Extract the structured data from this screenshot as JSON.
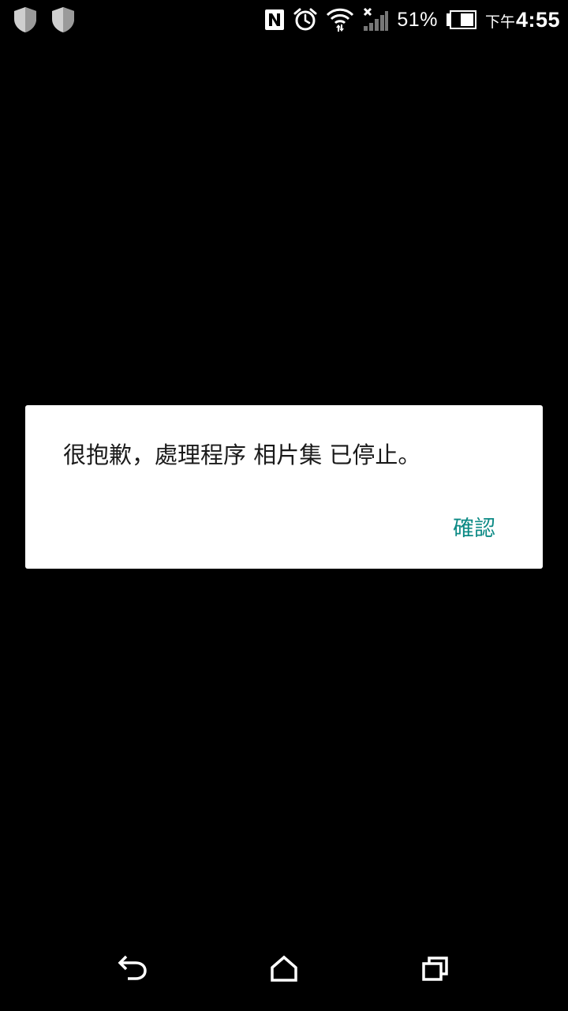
{
  "status_bar": {
    "left_icons": [
      "shield-icon",
      "shield-icon"
    ],
    "right_icons": [
      "nfc-icon",
      "alarm-clock-icon",
      "wifi-icon",
      "no-signal-icon",
      "battery-icon"
    ],
    "battery_percent": "51%",
    "clock_ampm": "下午",
    "clock_time": "4:55"
  },
  "dialog": {
    "message": "很抱歉，處理程序 相片集 已停止。",
    "ok_label": "確認",
    "accent_color": "#0c8a85"
  },
  "nav_bar": {
    "icons": [
      "back-icon",
      "home-icon",
      "recent-apps-icon"
    ]
  }
}
